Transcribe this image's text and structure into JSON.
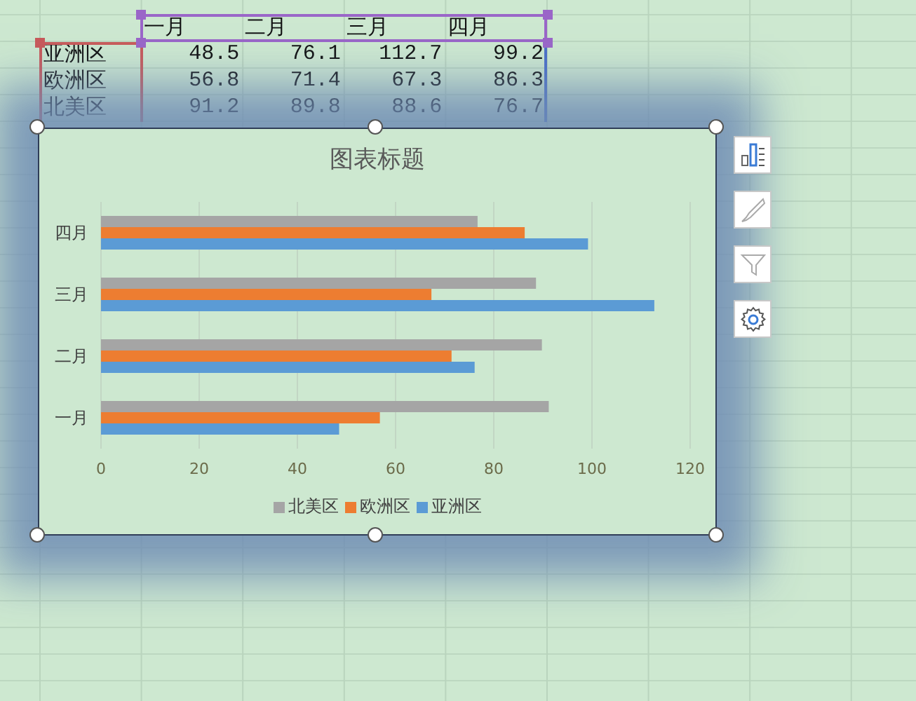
{
  "table": {
    "columns": [
      "一月",
      "二月",
      "三月",
      "四月"
    ],
    "rows": [
      {
        "label": "亚洲区",
        "values": [
          "48.5",
          "76.1",
          "112.7",
          "99.2"
        ]
      },
      {
        "label": "欧洲区",
        "values": [
          "56.8",
          "71.4",
          "67.3",
          "86.3"
        ]
      },
      {
        "label": "北美区",
        "values": [
          "91.2",
          "89.8",
          "88.6",
          "76.7"
        ]
      }
    ]
  },
  "chart": {
    "chart_data": {
      "type": "bar",
      "orientation": "horizontal",
      "title": "图表标题",
      "categories": [
        "四月",
        "三月",
        "二月",
        "一月"
      ],
      "series": [
        {
          "name": "亚洲区",
          "color": "#5b9bd5",
          "values": [
            99.2,
            112.7,
            76.1,
            48.5
          ]
        },
        {
          "name": "欧洲区",
          "color": "#ed7d31",
          "values": [
            86.3,
            67.3,
            71.4,
            56.8
          ]
        },
        {
          "name": "北美区",
          "color": "#a5a5a5",
          "values": [
            76.7,
            88.6,
            89.8,
            91.2
          ]
        }
      ],
      "xlim": [
        0,
        120
      ],
      "xticks": [
        0,
        20,
        40,
        60,
        80,
        100,
        120
      ],
      "grid": true,
      "legend": true
    }
  },
  "chart_tools": [
    {
      "kind": "elements"
    },
    {
      "kind": "styles"
    },
    {
      "kind": "filter"
    },
    {
      "kind": "settings"
    }
  ]
}
